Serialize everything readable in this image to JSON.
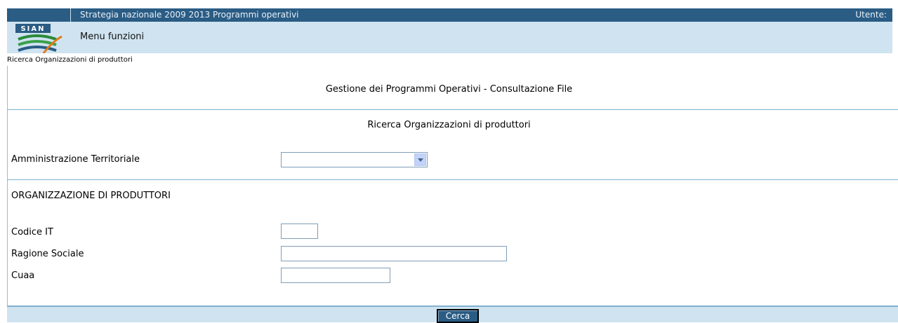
{
  "header": {
    "title": "Strategia nazionale 2009 2013 Programmi operativi",
    "user_label": "Utente:",
    "logo_text": "SIAN",
    "menu_label": "Menu funzioni"
  },
  "breadcrumb": "Ricerca Organizzazioni di produttori",
  "main": {
    "page_title": "Gestione dei Programmi Operativi - Consultazione File",
    "section_title": "Ricerca Organizzazioni di produttori",
    "amministrazione": {
      "label": "Amministrazione Territoriale",
      "selected": ""
    },
    "org_heading": "ORGANIZZAZIONE DI PRODUTTORI",
    "fields": {
      "codice_it": {
        "label": "Codice IT",
        "value": ""
      },
      "ragione_sociale": {
        "label": "Ragione Sociale",
        "value": ""
      },
      "cuaa": {
        "label": "Cuaa",
        "value": ""
      }
    },
    "search_button": "Cerca"
  },
  "colors": {
    "header_dark": "#2a5c84",
    "header_light": "#cfe3f0",
    "rule": "#7fb2d0"
  }
}
